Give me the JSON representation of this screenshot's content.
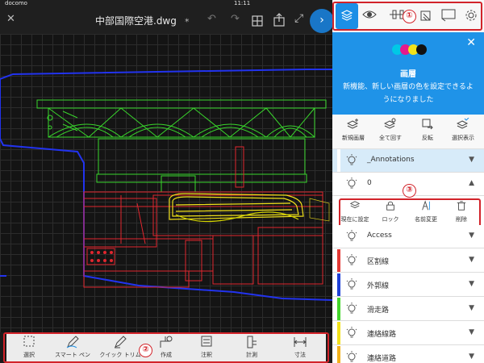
{
  "status_bar": {
    "carrier": "docomo",
    "time": "11:11"
  },
  "toolbar": {
    "file_name": "中部国際空港.dwg"
  },
  "bottom_toolbar": {
    "tools": [
      {
        "label": "選択",
        "icon": "select-rect-icon"
      },
      {
        "label": "スマート ペン",
        "icon": "smart-pen-icon"
      },
      {
        "label": "クイック トリム",
        "icon": "quick-trim-icon"
      },
      {
        "label": "作成",
        "icon": "create-icon"
      },
      {
        "label": "注釈",
        "icon": "annotation-icon"
      },
      {
        "label": "計測",
        "icon": "measure-icon"
      },
      {
        "label": "寸法",
        "icon": "dimension-icon"
      }
    ]
  },
  "panel": {
    "tabs": [
      {
        "name": "layers",
        "icon": "layers-icon",
        "active": true
      },
      {
        "name": "visibility",
        "icon": "eye-icon"
      },
      {
        "name": "properties",
        "icon": "sliders-icon"
      },
      {
        "name": "blocks",
        "icon": "blocks-icon"
      },
      {
        "name": "views",
        "icon": "views-icon"
      },
      {
        "name": "settings",
        "icon": "gear-icon"
      }
    ],
    "hero": {
      "title": "画層",
      "description": "新機能、新しい画層の色を設定できるようになりました"
    },
    "actions": [
      {
        "label": "新規画層",
        "icon": "new-layer-icon"
      },
      {
        "label": "全て回す",
        "icon": "all-layers-icon"
      },
      {
        "label": "反転",
        "icon": "invert-icon"
      },
      {
        "label": "選択表示",
        "icon": "show-selected-icon"
      }
    ],
    "layer_actions": [
      {
        "label": "現在に設定",
        "icon": "set-current-icon"
      },
      {
        "label": "ロック",
        "icon": "lock-icon"
      },
      {
        "label": "名前変更",
        "icon": "rename-icon"
      },
      {
        "label": "削除",
        "icon": "delete-icon"
      }
    ],
    "layers": [
      {
        "name": "_Annotations",
        "color": "#ffffff",
        "selected": true
      },
      {
        "name": "0",
        "color": "#ffffff",
        "expanded": true
      },
      {
        "name": "Access",
        "color": "#ffffff"
      },
      {
        "name": "区割線",
        "color": "#e53935"
      },
      {
        "name": "外郭線",
        "color": "#1e3fd8"
      },
      {
        "name": "滑走路",
        "color": "#44d62c"
      },
      {
        "name": "連絡線路",
        "color": "#f2e21b"
      },
      {
        "name": "連絡道路",
        "color": "#f2b21b"
      }
    ]
  },
  "annotations": [
    "①",
    "②",
    "③"
  ],
  "colors": {
    "accent": "#1b8fe6",
    "callout": "#d2232a",
    "panel_hero": "#1f93e8"
  }
}
